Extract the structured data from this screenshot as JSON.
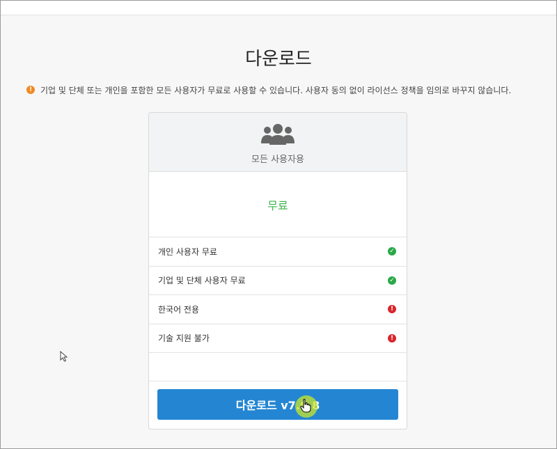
{
  "page": {
    "title": "다운로드",
    "notice": "기업 및 단체 또는 개인을 포함한 모든 사용자가 무료로 사용할 수 있습니다. 사용자 동의 없이 라이선스 정책을 임의로 바꾸지 않습니다."
  },
  "plan": {
    "name": "모든 사용자용",
    "price": "무료",
    "features": [
      {
        "label": "개인 사용자 무료",
        "status": "check"
      },
      {
        "label": "기업 및 단체 사용자 무료",
        "status": "check"
      },
      {
        "label": "한국어 전용",
        "status": "exclamation"
      },
      {
        "label": "기술 지원 불가",
        "status": "exclamation"
      }
    ],
    "download_label": "다운로드 v7.0.8"
  },
  "colors": {
    "accent": "#2486d3",
    "success": "#2aa847",
    "error": "#d9262c",
    "warning": "#f08a24",
    "price": "#3cb44a"
  }
}
